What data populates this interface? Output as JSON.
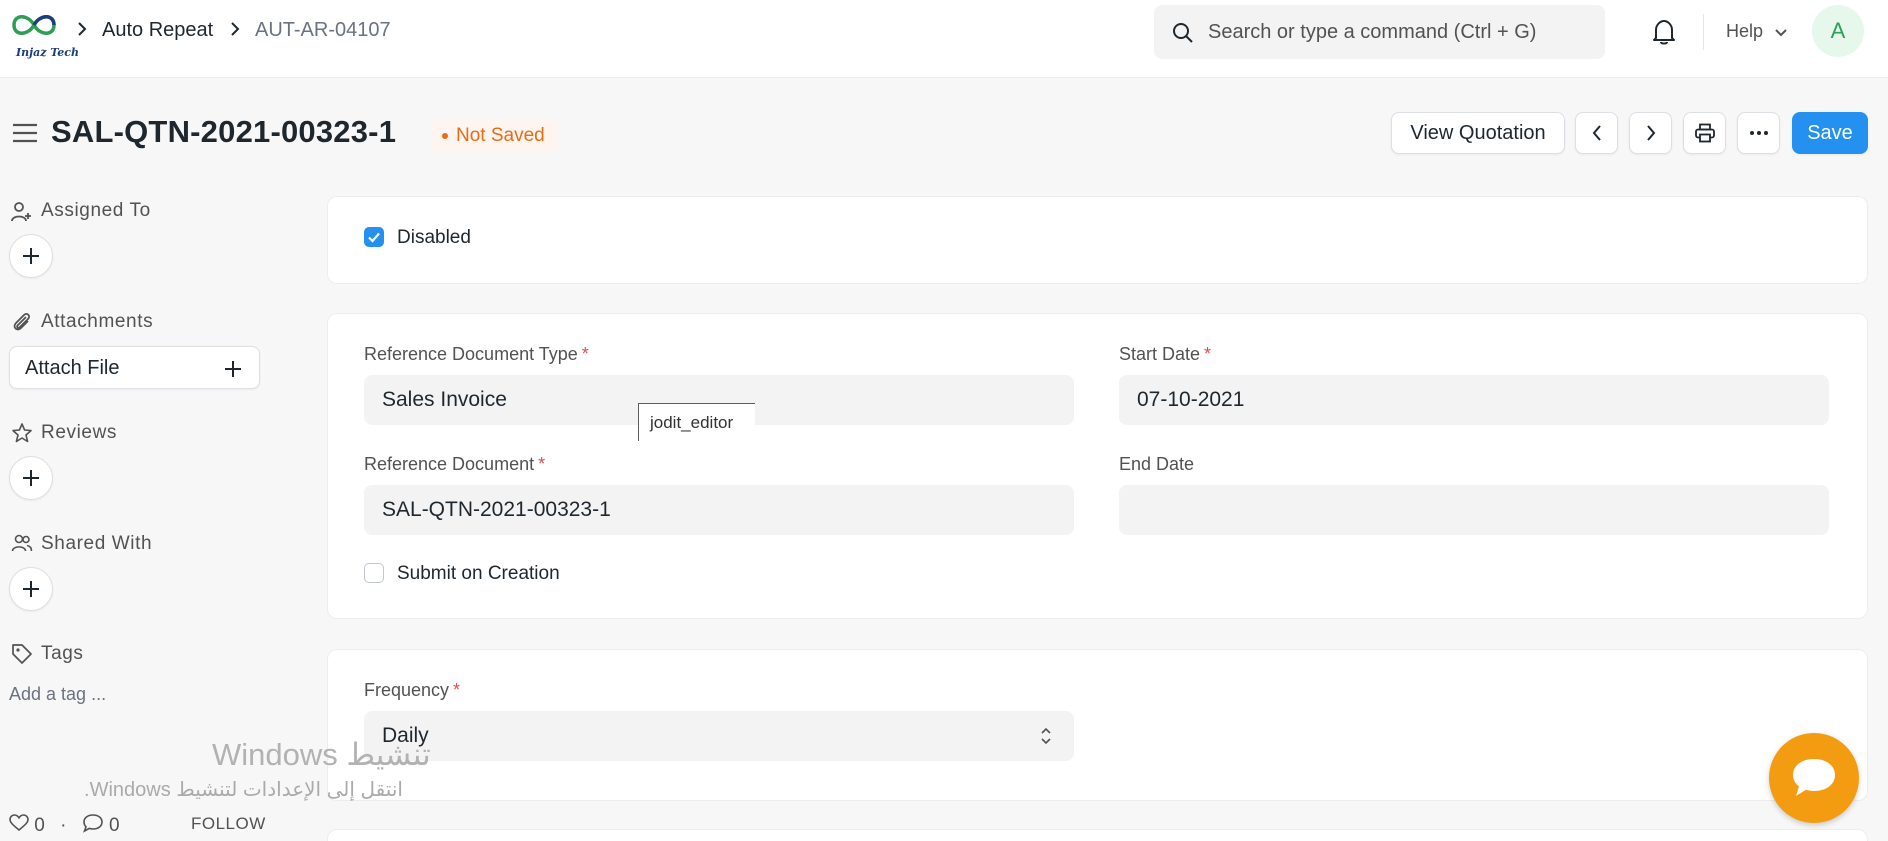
{
  "navbar": {
    "logo_text": "Injaz Tech",
    "breadcrumbs": [
      "Auto Repeat",
      "AUT-AR-04107"
    ],
    "search_placeholder": "Search or type a command (Ctrl + G)",
    "help_label": "Help",
    "avatar_initial": "A"
  },
  "page": {
    "title": "SAL-QTN-2021-00323-1",
    "status": "Not Saved",
    "actions": {
      "view_label": "View Quotation",
      "save_label": "Save"
    }
  },
  "sidebar": {
    "assigned_to": "Assigned To",
    "attachments": "Attachments",
    "attach_file": "Attach File",
    "reviews": "Reviews",
    "shared_with": "Shared With",
    "tags": "Tags",
    "add_tag": "Add a tag ...",
    "likes": "0",
    "comments": "0",
    "follow": "FOLLOW"
  },
  "form": {
    "disabled": {
      "label": "Disabled",
      "checked": true
    },
    "reference_doctype": {
      "label": "Reference Document Type",
      "value": "Sales Invoice",
      "required": true
    },
    "start_date": {
      "label": "Start Date",
      "value": "07-10-2021",
      "required": true
    },
    "reference_document": {
      "label": "Reference Document",
      "value": "SAL-QTN-2021-00323-1",
      "required": true
    },
    "end_date": {
      "label": "End Date",
      "value": ""
    },
    "submit_on_creation": {
      "label": "Submit on Creation",
      "checked": false
    },
    "frequency": {
      "label": "Frequency",
      "value": "Daily",
      "required": true
    }
  },
  "tooltip": "jodit_editor",
  "watermark": {
    "line1": "تنشيط Windows",
    "line2": "انتقل إلى الإعدادات لتنشيط Windows."
  },
  "colors": {
    "primary": "#2490ef",
    "status": "#e86c13",
    "chat": "#f39c12"
  }
}
